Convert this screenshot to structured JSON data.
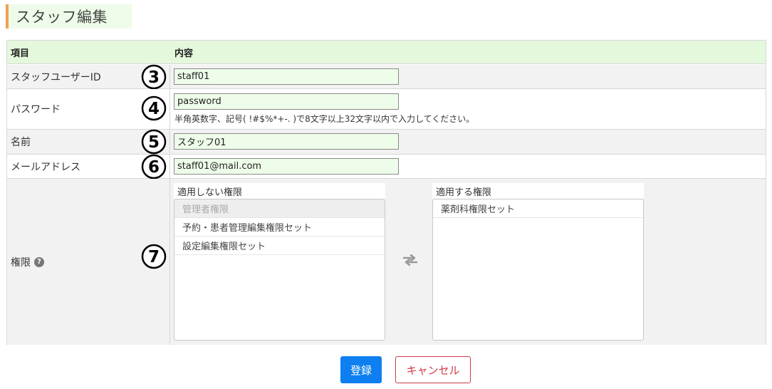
{
  "page": {
    "title": "スタッフ編集"
  },
  "table": {
    "headers": {
      "item": "項目",
      "content": "内容"
    },
    "rows": {
      "staff_id": {
        "label": "スタッフユーザーID",
        "value": "staff01",
        "marker": "3"
      },
      "password": {
        "label": "パスワード",
        "value": "password",
        "marker": "4",
        "hint": "半角英数字、記号( !#$%*+-. )で8文字以上32文字以内で入力してください。"
      },
      "name": {
        "label": "名前",
        "value": "スタッフ01",
        "marker": "5"
      },
      "email": {
        "label": "メールアドレス",
        "value": "staff01@mail.com",
        "marker": "6"
      },
      "permissions": {
        "label": "権限",
        "marker": "7",
        "unapplied_title": "適用しない権限",
        "unapplied_items": [
          {
            "label": "管理者権限",
            "disabled": true
          },
          {
            "label": "予約・患者管理編集権限セット",
            "disabled": false
          },
          {
            "label": "設定編集権限セット",
            "disabled": false
          }
        ],
        "applied_title": "適用する権限",
        "applied_items": [
          {
            "label": "薬剤科権限セット",
            "disabled": false
          }
        ]
      }
    }
  },
  "buttons": {
    "submit": "登録",
    "cancel": "キャンセル"
  },
  "colors": {
    "primary": "#0d7ff0",
    "cancel": "#d03a4a",
    "header_bg": "#e4f8dc",
    "input_bg": "#eefde9"
  }
}
